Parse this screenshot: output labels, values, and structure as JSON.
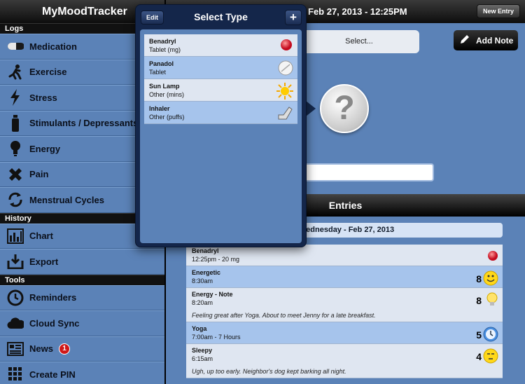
{
  "app": {
    "title": "MyMoodTracker"
  },
  "sidebar": {
    "sections": [
      {
        "label": "Logs",
        "items": [
          {
            "label": "Medication",
            "icon": "pill-icon"
          },
          {
            "label": "Exercise",
            "icon": "runner-icon"
          },
          {
            "label": "Stress",
            "icon": "lightning-icon"
          },
          {
            "label": "Stimulants / Depressants",
            "icon": "bottle-icon"
          },
          {
            "label": "Energy",
            "icon": "lightbulb-icon"
          },
          {
            "label": "Pain",
            "icon": "bandage-icon"
          },
          {
            "label": "Menstrual Cycles",
            "icon": "cycle-icon"
          }
        ]
      },
      {
        "label": "History",
        "items": [
          {
            "label": "Chart",
            "icon": "bar-chart-icon"
          },
          {
            "label": "Export",
            "icon": "export-icon"
          }
        ]
      },
      {
        "label": "Tools",
        "items": [
          {
            "label": "Reminders",
            "icon": "clock-icon"
          },
          {
            "label": "Cloud Sync",
            "icon": "cloud-icon"
          },
          {
            "label": "News",
            "icon": "news-icon",
            "badge": "1"
          },
          {
            "label": "Create PIN",
            "icon": "keypad-icon"
          }
        ]
      }
    ]
  },
  "topbar": {
    "date": "Feb 27, 2013 - 12:25PM",
    "new_entry": "New Entry"
  },
  "editor": {
    "select_placeholder": "Select...",
    "add_note": "Add Note",
    "unknown_symbol": "?"
  },
  "entries": {
    "title": "Entries",
    "day": "Wednesday - Feb 27, 2013",
    "items": [
      {
        "title": "Benadryl",
        "sub": "12:25pm - 20 mg",
        "note": "",
        "value": "",
        "icon": "red-pill-icon"
      },
      {
        "title": "Energetic",
        "sub": "8:30am",
        "note": "",
        "value": "8",
        "icon": "smiley-icon"
      },
      {
        "title": "Energy - Note",
        "sub": "8:20am",
        "note": "Feeling great after Yoga. About to meet Jenny for a late breakfast.",
        "value": "8",
        "icon": "lightbulb-icon"
      },
      {
        "title": "Yoga",
        "sub": "7:00am - 7 Hours",
        "note": "",
        "value": "5",
        "icon": "clock-icon"
      },
      {
        "title": "Sleepy",
        "sub": "6:15am",
        "note": "Ugh, up too early. Neighbor's dog kept barking all night.",
        "value": "4",
        "icon": "sleepy-face-icon"
      }
    ]
  },
  "popover": {
    "title": "Select Type",
    "edit": "Edit",
    "add": "+",
    "items": [
      {
        "name": "Benadryl",
        "unit": "Tablet (mg)",
        "icon": "red-pill-icon"
      },
      {
        "name": "Panadol",
        "unit": "Tablet",
        "icon": "white-tablet-icon"
      },
      {
        "name": "Sun Lamp",
        "unit": "Other (mins)",
        "icon": "sun-icon"
      },
      {
        "name": "Inhaler",
        "unit": "Other (puffs)",
        "icon": "inhaler-icon"
      }
    ]
  },
  "colors": {
    "panel_blue": "#5b82b7",
    "row_blue": "#a6c4ec",
    "row_light": "#dfe6f1",
    "popover": "#14264a"
  }
}
